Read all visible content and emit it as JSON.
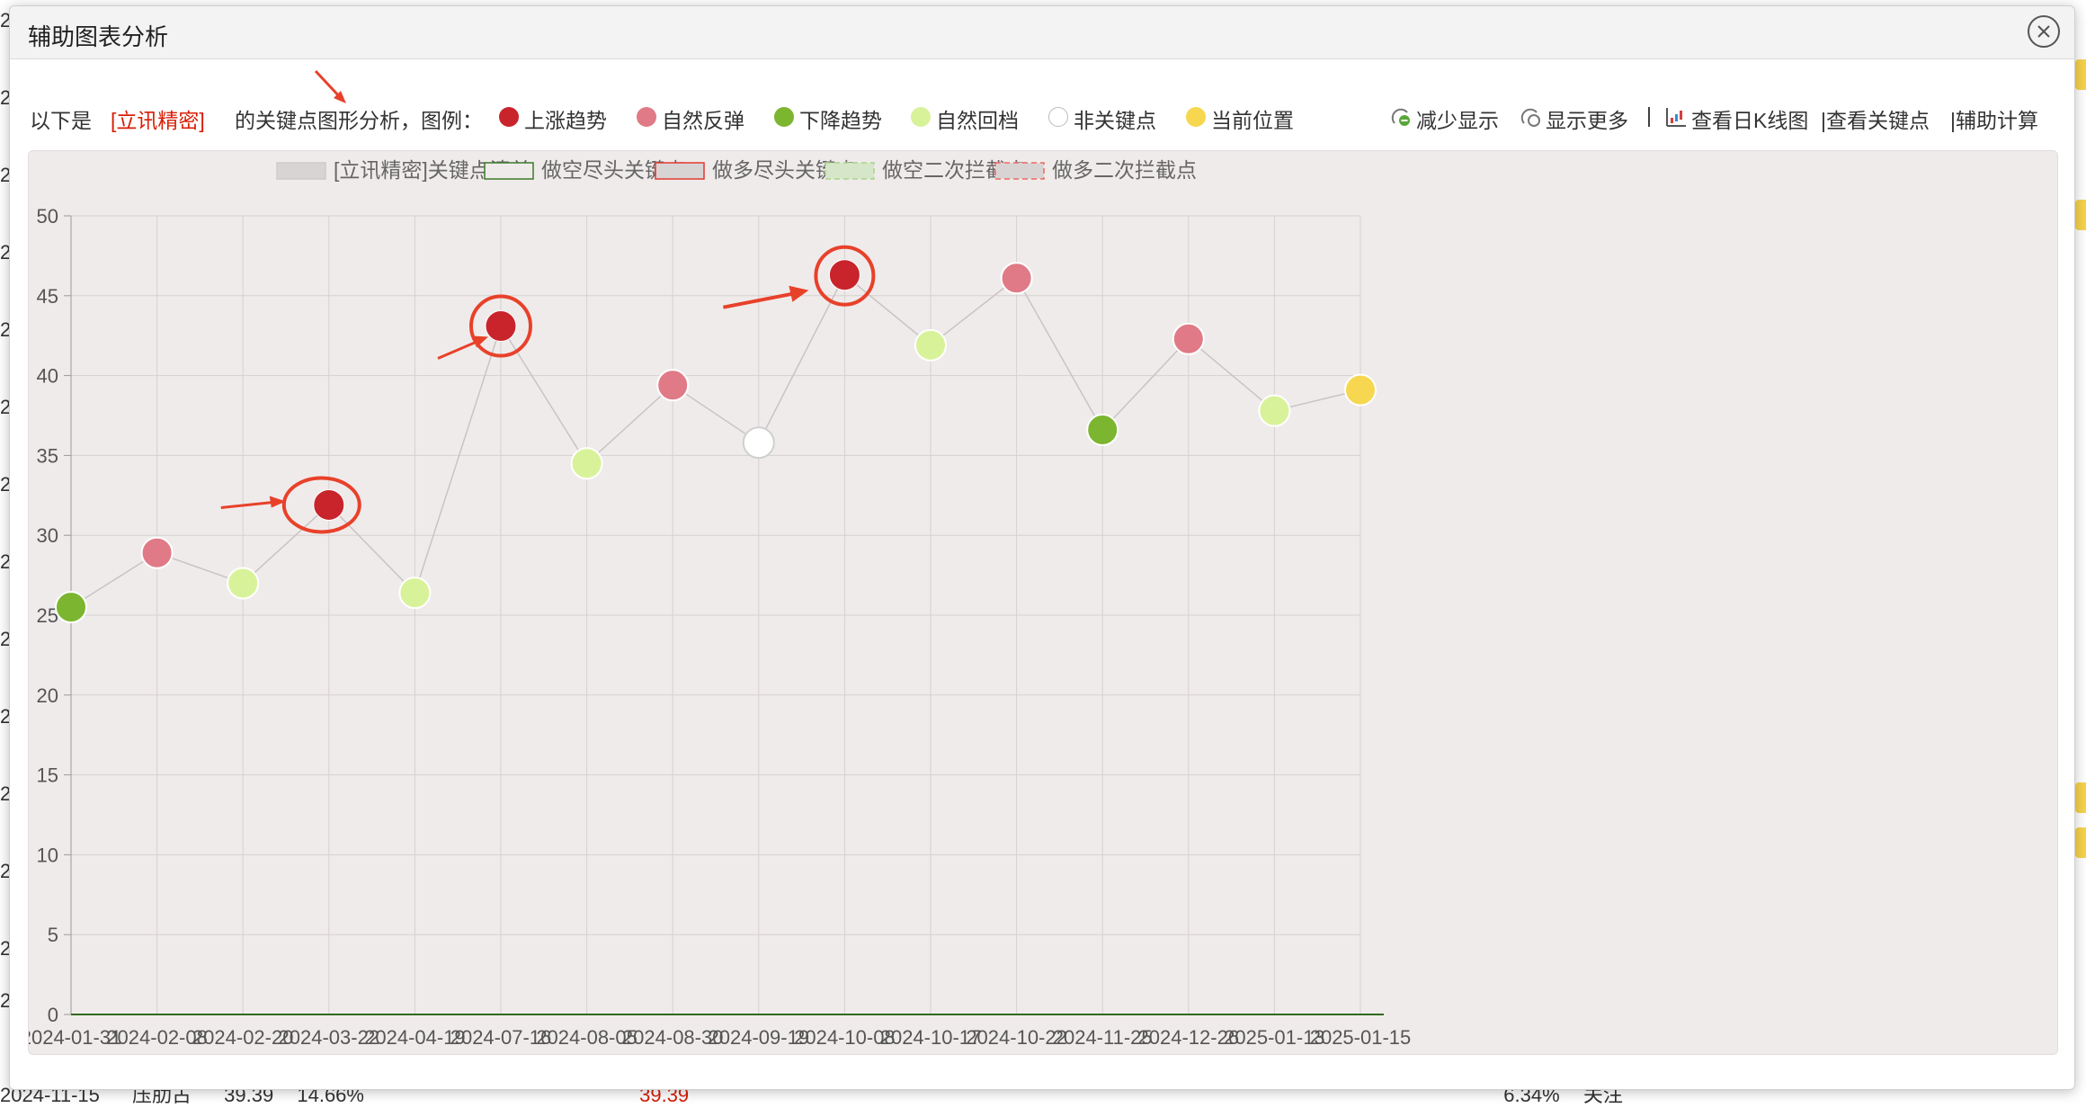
{
  "modal": {
    "title": "辅助图表分析"
  },
  "info": {
    "prefix": "以下是",
    "stock_name": "[立讯精密]",
    "suffix": "的关键点图形分析，图例：",
    "legend": [
      {
        "label": "上涨趋势",
        "color": "#c9242b"
      },
      {
        "label": "自然反弹",
        "color": "#e07a86"
      },
      {
        "label": "下降趋势",
        "color": "#7cb52f"
      },
      {
        "label": "自然回档",
        "color": "#d8f29a"
      },
      {
        "label": "非关键点",
        "color": "#ffffff"
      },
      {
        "label": "当前位置",
        "color": "#f7d750"
      }
    ],
    "tools": {
      "reduce": "减少显示",
      "more": "显示更多",
      "sep": "|",
      "daily_k": "查看日K线图",
      "key_points": "|查看关键点",
      "calc": "|辅助计算"
    }
  },
  "background": {
    "bottom_row": {
      "date": "2024-11-15",
      "c1": "压肋古",
      "c2": "39.39",
      "c3": "14.66%",
      "c4": "39.39",
      "c5": "6.34%",
      "c6": "关注"
    }
  },
  "chart_data": {
    "type": "line",
    "legend": [
      {
        "label": "[立讯精密]关键点清单",
        "style": "gray-fill"
      },
      {
        "label": "做空尽头关键点",
        "style": "green-border"
      },
      {
        "label": "做多尽头关键点",
        "style": "red-border"
      },
      {
        "label": "做空二次拦截点",
        "style": "green-dashed"
      },
      {
        "label": "做多二次拦截点",
        "style": "red-dashed"
      }
    ],
    "categories": [
      "2024-01-31",
      "2024-02-08",
      "2024-02-20",
      "2024-03-22",
      "2024-04-19",
      "2024-07-16",
      "2024-08-05",
      "2024-08-30",
      "2024-09-19",
      "2024-10-08",
      "2024-10-17",
      "2024-10-22",
      "2024-11-25",
      "2024-12-26",
      "2025-01-13",
      "2025-01-15"
    ],
    "values": [
      25.5,
      28.9,
      27.0,
      31.9,
      26.4,
      43.1,
      34.5,
      39.4,
      35.8,
      46.3,
      41.9,
      46.1,
      36.6,
      42.3,
      37.8,
      39.1
    ],
    "point_types": [
      "下降趋势",
      "自然反弹",
      "自然回档",
      "上涨趋势",
      "自然回档",
      "上涨趋势",
      "自然回档",
      "自然反弹",
      "非关键点",
      "上涨趋势",
      "自然回档",
      "自然反弹",
      "下降趋势",
      "自然反弹",
      "自然回档",
      "当前位置"
    ],
    "type_colors": {
      "上涨趋势": "#c9242b",
      "自然反弹": "#e07a86",
      "下降趋势": "#7cb52f",
      "自然回档": "#d8f29a",
      "非关键点": "#ffffff",
      "当前位置": "#f7d750"
    },
    "y_ticks": [
      0,
      5,
      10,
      15,
      20,
      25,
      30,
      35,
      40,
      45,
      50
    ],
    "ylim": [
      0,
      50
    ],
    "grid": true,
    "legend_position": "top",
    "highlighted_points": [
      "2024-03-22",
      "2024-07-16",
      "2024-10-08"
    ]
  }
}
